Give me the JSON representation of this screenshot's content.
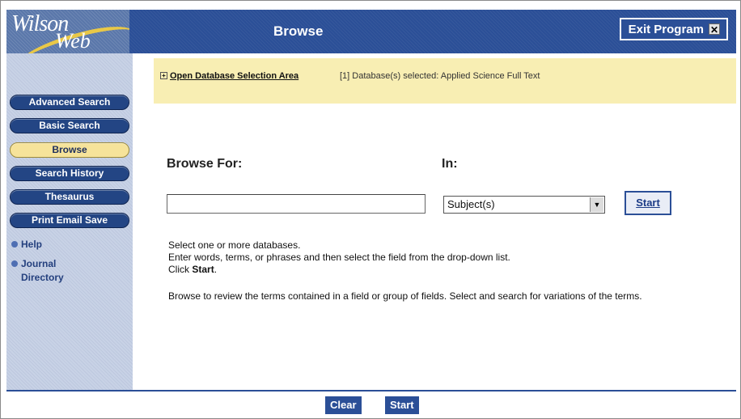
{
  "header": {
    "logo_line1": "Wilson",
    "logo_line2": "Web",
    "title": "Browse",
    "exit_label": "Exit Program",
    "exit_icon": "close-box-icon"
  },
  "sidebar": {
    "buttons": [
      {
        "label": "Advanced Search",
        "active": false
      },
      {
        "label": "Basic Search",
        "active": false
      },
      {
        "label": "Browse",
        "active": true
      },
      {
        "label": "Search History",
        "active": false
      },
      {
        "label": "Thesaurus",
        "active": false
      },
      {
        "label": "Print Email Save",
        "active": false
      }
    ],
    "links": [
      {
        "label": "Help"
      },
      {
        "label": "Journal Directory"
      }
    ]
  },
  "database": {
    "link_label": "Open Database Selection Area",
    "selected_text": "[1] Database(s) selected: Applied Science Full Text"
  },
  "browse": {
    "browse_for_label": "Browse For:",
    "in_label": "In:",
    "input_value": "",
    "field_selected": "Subject(s)",
    "start_label": "Start"
  },
  "instructions": {
    "line1": "Select one or more databases.",
    "line2": "Enter words, terms, or phrases and then select the field from the drop-down list.",
    "line3_prefix": "Click ",
    "line3_bold": "Start",
    "line3_suffix": ".",
    "paragraph2": "Browse to review the terms contained in a field or group of fields. Select and search for variations of the terms."
  },
  "footer": {
    "clear_label": "Clear",
    "start_label": "Start"
  },
  "colors": {
    "header_blue": "#2b4f97",
    "active_button": "#f6e39a",
    "db_band": "#f8eeb3",
    "sidebar_bg": "#c8d2e6"
  }
}
